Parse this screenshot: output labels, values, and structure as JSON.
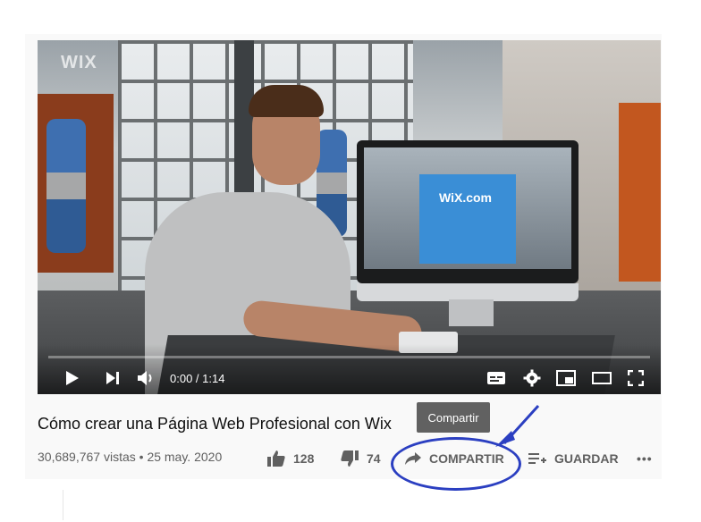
{
  "player": {
    "watermark": "WIX",
    "time": "0:00 / 1:14",
    "progress_fraction": 0.0,
    "monitor_logo": "WiX.com"
  },
  "video": {
    "title": "Cómo crear una Página Web Profesional con Wix",
    "views": "30,689,767 vistas",
    "separator": "•",
    "date": "25 may. 2020"
  },
  "actions": {
    "like_count": "128",
    "dislike_count": "74",
    "share_label": "COMPARTIR",
    "save_label": "GUARDAR",
    "more_label": "•••"
  },
  "tooltip": {
    "text": "Compartir"
  },
  "annotation": {
    "color": "#2b3fc1"
  },
  "icons": [
    "play-icon",
    "next-icon",
    "volume-icon",
    "subtitles-icon",
    "settings-icon",
    "miniplayer-icon",
    "theater-icon",
    "fullscreen-icon",
    "thumbs-up-icon",
    "thumbs-down-icon",
    "share-icon",
    "playlist-add-icon",
    "more-icon"
  ]
}
